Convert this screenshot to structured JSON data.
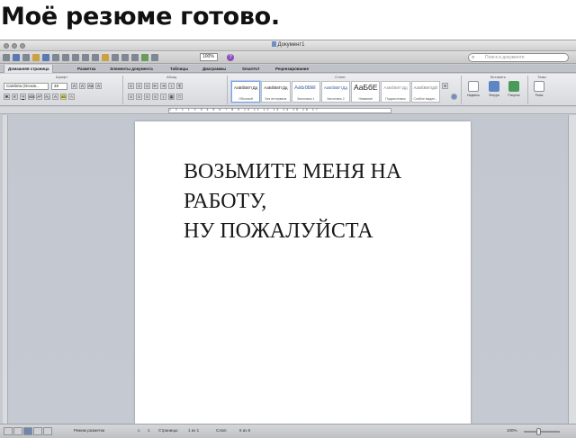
{
  "caption": "Моё резюме готово.",
  "window": {
    "title": "Документ1"
  },
  "toolbar": {
    "zoom": "100%",
    "search_placeholder": "Поиск в документе"
  },
  "tabs": [
    "Домашняя страница",
    "Разметка",
    "Элементы документа",
    "Таблицы",
    "Диаграммы",
    "SmartArt",
    "Рецензирование"
  ],
  "ribbon": {
    "group_font": "Шрифт",
    "group_paragraph": "Абзац",
    "group_styles": "Стили",
    "group_insert": "Вставить",
    "group_themes": "Темы",
    "font_name": "Cambria (Основ...",
    "font_size": "48",
    "styles": [
      {
        "sample": "АаБбВвГгДд",
        "name": "Обычный"
      },
      {
        "sample": "АаБбВвГгДд",
        "name": "Без интервала"
      },
      {
        "sample": "АаБбВвГ",
        "name": "Заголовок 1"
      },
      {
        "sample": "АаБбВвГгДд",
        "name": "Заголовок 2"
      },
      {
        "sample": "АаБбЕ",
        "name": "Название"
      },
      {
        "sample": "АаБбВвГгДд",
        "name": "Подзаголовок"
      },
      {
        "sample": "АаБбВвГгДд",
        "name": "Слабое выдел..."
      }
    ],
    "insert_items": [
      "Надпись",
      "Фигура",
      "Рисунок",
      "Темы"
    ]
  },
  "ruler_numbers": "1 2 1 1 2 3 4 5 6 7 8 9 10 11 12 13 14 15 16 17",
  "document": {
    "lines": [
      "ВОЗЬМИТЕ МЕНЯ НА",
      "РАБОТУ,",
      "НУ ПОЖАЛУЙСТА"
    ]
  },
  "status": {
    "view": "Режим разметки",
    "section_label": "с.",
    "section_value": "1",
    "pages_label": "Страницы:",
    "pages_value": "1 из 1",
    "words_label": "Слов:",
    "words_value": "6 из 6",
    "zoom": "100%"
  },
  "colors": {
    "accent": "#7a9ed6",
    "canvas": "#c3c7cf"
  }
}
